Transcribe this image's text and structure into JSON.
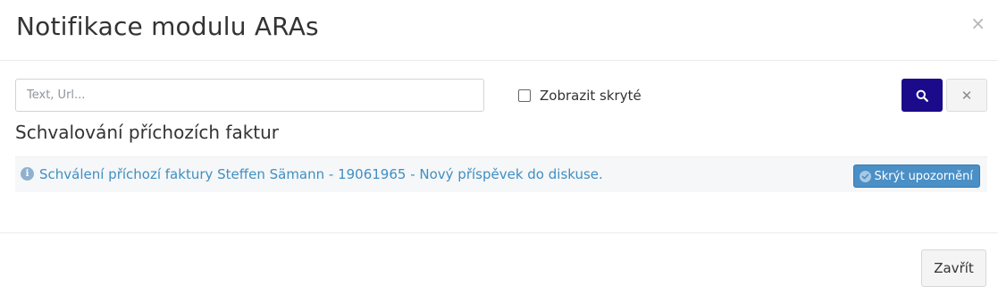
{
  "modal": {
    "title": "Notifikace modulu ARAs",
    "close_glyph": "×"
  },
  "toolbar": {
    "search_placeholder": "Text, Url...",
    "search_value": "",
    "show_hidden_label": "Zobrazit skryté",
    "show_hidden_checked": false,
    "search_icon": "search-icon",
    "clear_glyph": "✕"
  },
  "section": {
    "title": "Schvalování příchozích faktur",
    "notifications": [
      {
        "icon": "info-icon",
        "text": "Schválení příchozí faktury Steffen Sämann - 19061965 - Nový příspěvek do diskuse.",
        "hide_label": "Skrýt upozornění"
      }
    ]
  },
  "footer": {
    "close_label": "Zavřít"
  },
  "colors": {
    "accent": "#1b0a8a",
    "link": "#3f8fc4",
    "hide_button": "#4a8fc6"
  }
}
